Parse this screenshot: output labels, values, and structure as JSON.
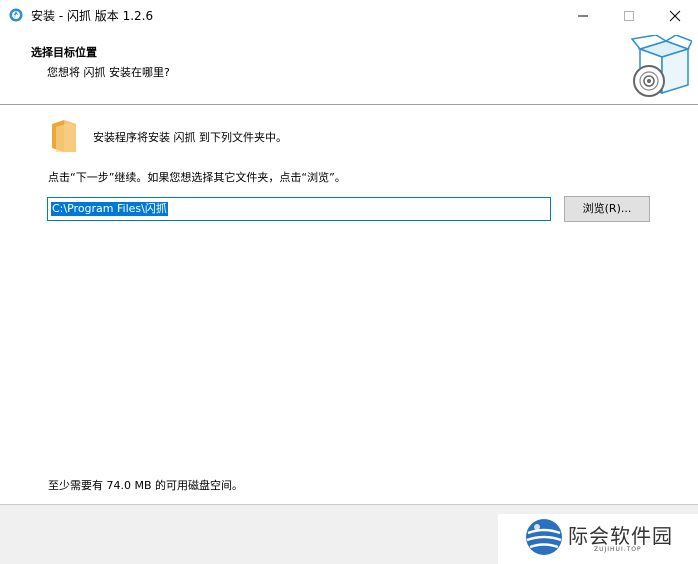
{
  "window": {
    "title": "安装 - 闪抓 版本 1.2.6",
    "icons": {
      "app": "app-logo-icon",
      "minimize": "minimize-icon",
      "maximize": "maximize-icon",
      "close": "close-icon"
    }
  },
  "header": {
    "title": "选择目标位置",
    "subtitle": "您想将 闪抓 安装在哪里?",
    "image": "setup-box-disc-icon"
  },
  "body": {
    "folder_icon": "folder-icon",
    "intro": "安装程序将安装 闪抓 到下列文件夹中。",
    "instruction": "点击“下一步”继续。如果您想选择其它文件夹，点击“浏览”。",
    "path_value": "C:\\Program Files\\闪抓",
    "browse_label": "浏览(R)...",
    "space_required": "至少需要有 74.0 MB 的可用磁盘空间。"
  },
  "watermark": {
    "name": "际会软件园",
    "sub": "ZUJIHUI.TOP"
  },
  "colors": {
    "accent": "#0078d7",
    "footer_bg": "#f0f0f0",
    "button_bg": "#e1e1e1",
    "folder": "#f5c26b"
  }
}
